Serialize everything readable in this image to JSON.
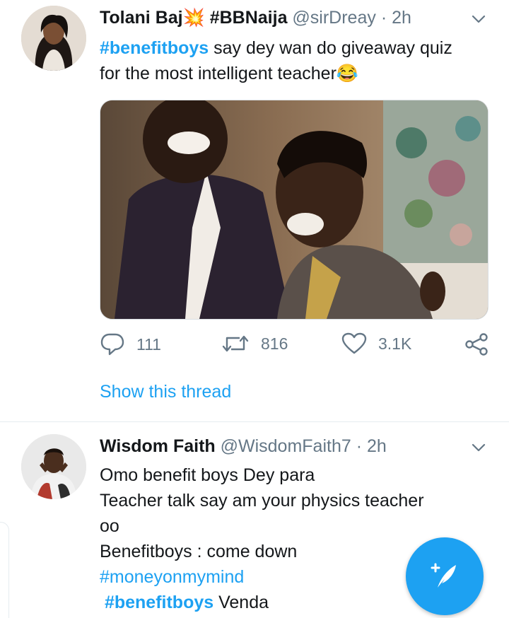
{
  "tweet1": {
    "name": "Tolani Baj",
    "name_emoji": "💥",
    "name_tag": "#BBNaija",
    "handle": "@sirDreay",
    "sep": "·",
    "time": "2h",
    "hashtag": "#benefitboys",
    "text_line1": " say dey wan do giveaway quiz",
    "text_line2": "for the most intelligent teacher",
    "emoji": "😂",
    "replies": "111",
    "retweets": "816",
    "likes": "3.1K",
    "show_thread": "Show this thread"
  },
  "tweet2": {
    "name": "Wisdom Faith",
    "handle": "@WisdomFaith7",
    "sep": "·",
    "time": "2h",
    "line1": "Omo benefit boys Dey para",
    "line2": "Teacher talk say am your physics teacher",
    "line3": "oo",
    "line4": "Benefitboys : come down",
    "hashtag1": "#moneyonmymind",
    "hashtag2": "#benefitboys",
    "line6_tail": " Venda"
  },
  "colors": {
    "accent": "#1da1f2",
    "text": "#14171a",
    "muted": "#657786",
    "divider": "#e6ecf0"
  },
  "icons": {
    "reply": "speech-bubble-icon",
    "retweet": "retweet-icon",
    "like": "heart-icon",
    "share": "share-icon",
    "more": "chevron-down-icon",
    "compose": "compose-feather-icon"
  }
}
